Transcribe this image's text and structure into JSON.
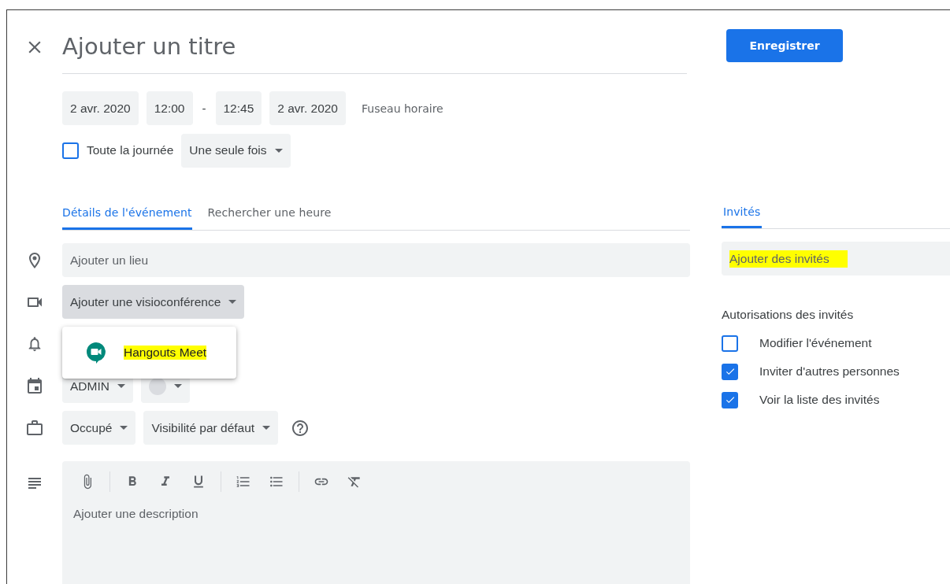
{
  "title": {
    "placeholder": "Ajouter un titre"
  },
  "save_button": "Enregistrer",
  "date_time": [
    {
      "kind": "field",
      "text": "2 avr. 2020"
    },
    {
      "kind": "field",
      "text": "12:00"
    },
    {
      "kind": "separator",
      "text": "-"
    },
    {
      "kind": "field",
      "text": "12:45"
    },
    {
      "kind": "field",
      "text": "2 avr. 2020"
    },
    {
      "kind": "link",
      "text": "Fuseau horaire"
    }
  ],
  "all_day": {
    "label": "Toute la journée",
    "checked": false
  },
  "recurrence": "Une seule fois",
  "tabs": [
    {
      "label": "Détails de l'événement",
      "selected": true
    },
    {
      "label": "Rechercher une heure",
      "selected": false
    }
  ],
  "location": {
    "placeholder": "Ajouter un lieu"
  },
  "conference": {
    "label": "Ajouter une visioconférence",
    "expanded": true,
    "options": [
      {
        "label": "Hangouts Meet",
        "highlighted": true
      }
    ]
  },
  "calendar": {
    "label": "ADMIN"
  },
  "availability": "Occupé",
  "visibility": "Visibilité par défaut",
  "description": {
    "placeholder": "Ajouter une description"
  },
  "guests": {
    "tabs": [
      {
        "label": "Invités",
        "selected": true
      }
    ],
    "field": {
      "placeholder": "Ajouter des invités",
      "highlighted": true
    },
    "permissions_title": "Autorisations des invités",
    "permissions": [
      {
        "label": "Modifier l'événement",
        "checked": false
      },
      {
        "label": "Inviter d'autres personnes",
        "checked": true
      },
      {
        "label": "Voir la liste des invités",
        "checked": true
      }
    ]
  }
}
